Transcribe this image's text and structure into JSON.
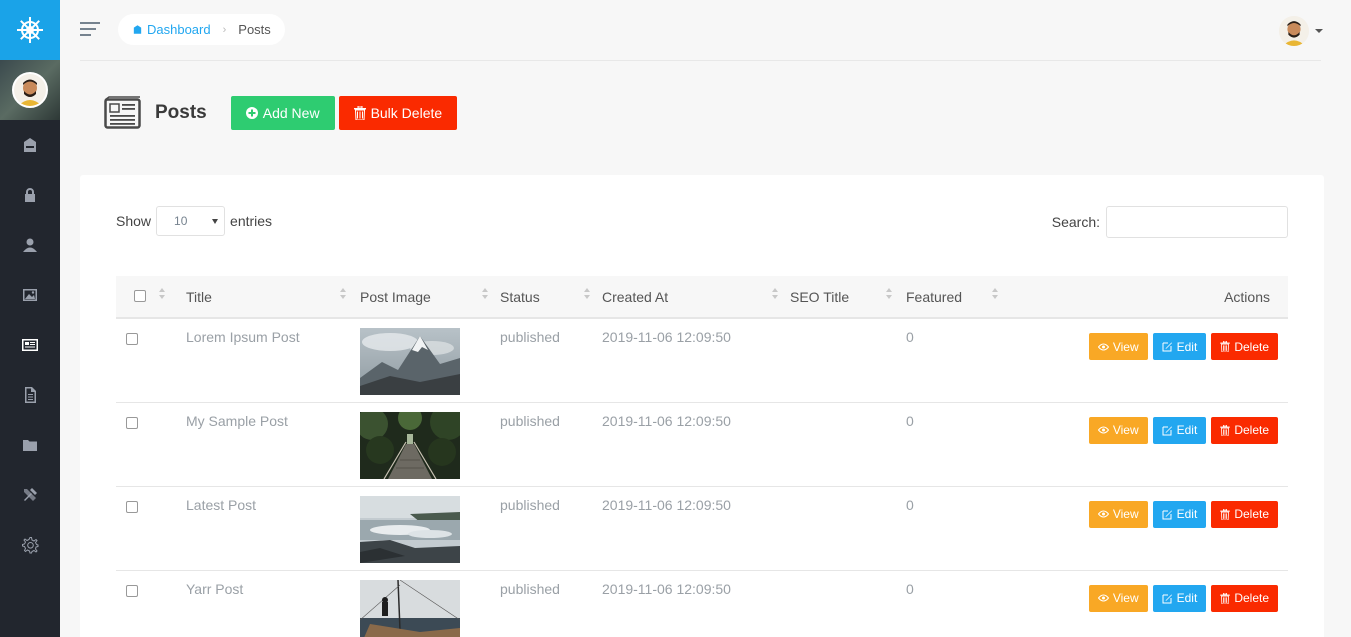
{
  "breadcrumb": {
    "home": "Dashboard",
    "current": "Posts"
  },
  "page": {
    "title": "Posts",
    "add_label": "Add New",
    "bulk_delete_label": "Bulk Delete"
  },
  "table_controls": {
    "show_label": "Show",
    "entries_value": "10",
    "entries_label": "entries",
    "search_label": "Search:",
    "search_value": ""
  },
  "columns": [
    "Title",
    "Post Image",
    "Status",
    "Created At",
    "SEO Title",
    "Featured",
    "Actions"
  ],
  "actions": {
    "view": "View",
    "edit": "Edit",
    "delete": "Delete"
  },
  "rows": [
    {
      "title": "Lorem Ipsum Post",
      "status": "published",
      "created_at": "2019-11-06 12:09:50",
      "seo_title": "",
      "featured": "0",
      "image": "mountain-image"
    },
    {
      "title": "My Sample Post",
      "status": "published",
      "created_at": "2019-11-06 12:09:50",
      "seo_title": "",
      "featured": "0",
      "image": "forest-bridge-image"
    },
    {
      "title": "Latest Post",
      "status": "published",
      "created_at": "2019-11-06 12:09:50",
      "seo_title": "",
      "featured": "0",
      "image": "waterfall-image"
    },
    {
      "title": "Yarr Post",
      "status": "published",
      "created_at": "2019-11-06 12:09:50",
      "seo_title": "",
      "featured": "0",
      "image": "sailboat-image"
    }
  ],
  "sidebar": {
    "items": [
      "dashboard-icon",
      "lock-icon",
      "user-icon",
      "image-icon",
      "news-icon",
      "document-icon",
      "folder-icon",
      "tools-icon",
      "gear-icon"
    ],
    "active": "news-icon"
  },
  "colors": {
    "brand": "#1aa3e8",
    "sidebar": "#22262e",
    "success": "#2ecc71",
    "danger": "#fa2a00",
    "warning": "#f9a825",
    "primary": "#22a7f0"
  }
}
